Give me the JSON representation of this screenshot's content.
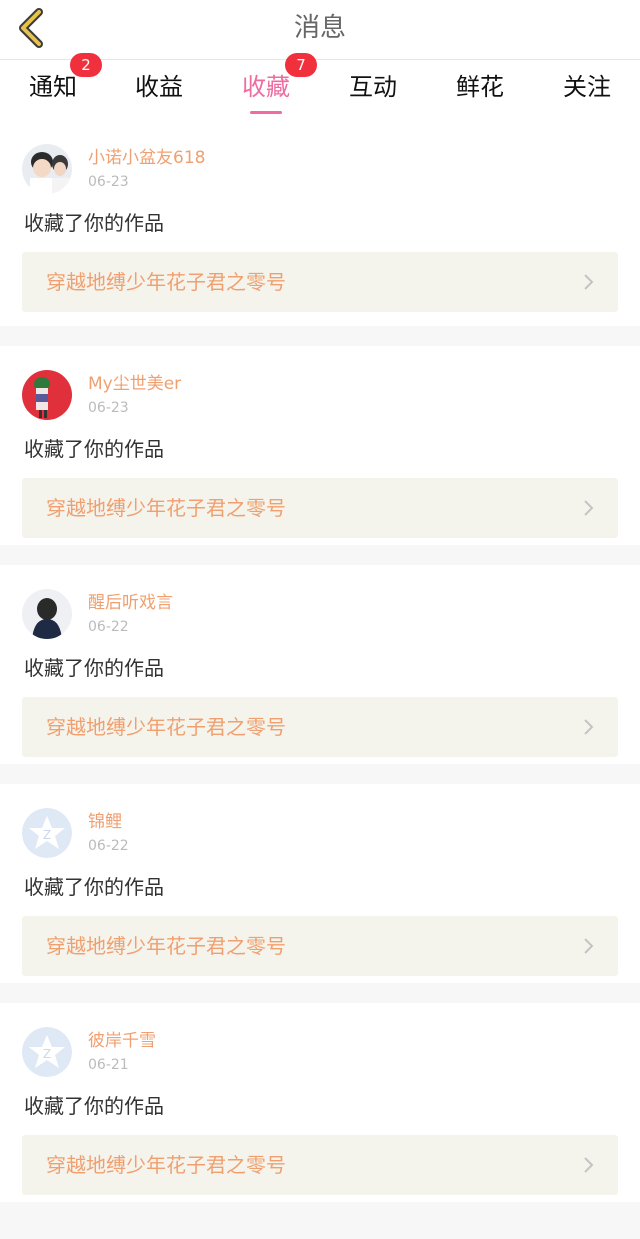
{
  "header": {
    "title": "消息"
  },
  "tabs": [
    {
      "label": "通知",
      "badge": "2"
    },
    {
      "label": "收益"
    },
    {
      "label": "收藏",
      "badge": "7",
      "active": true
    },
    {
      "label": "互动"
    },
    {
      "label": "鲜花"
    },
    {
      "label": "关注"
    }
  ],
  "messages": [
    {
      "user": "小诺小盆友618",
      "date": "06-23",
      "action": "收藏了你的作品",
      "work": "穿越地缚少年花子君之零号"
    },
    {
      "user": "My尘世美er",
      "date": "06-23",
      "action": "收藏了你的作品",
      "work": "穿越地缚少年花子君之零号"
    },
    {
      "user": "醒后听戏言",
      "date": "06-22",
      "action": "收藏了你的作品",
      "work": "穿越地缚少年花子君之零号"
    },
    {
      "user": "锦鲤",
      "date": "06-22",
      "action": "收藏了你的作品",
      "work": "穿越地缚少年花子君之零号"
    },
    {
      "user": "彼岸千雪",
      "date": "06-21",
      "action": "收藏了你的作品",
      "work": "穿越地缚少年花子君之零号"
    }
  ],
  "colors": {
    "accent": "#f06ba0",
    "username": "#f0a070",
    "badge": "#f0303d",
    "back_icon": "#d4a42a"
  }
}
